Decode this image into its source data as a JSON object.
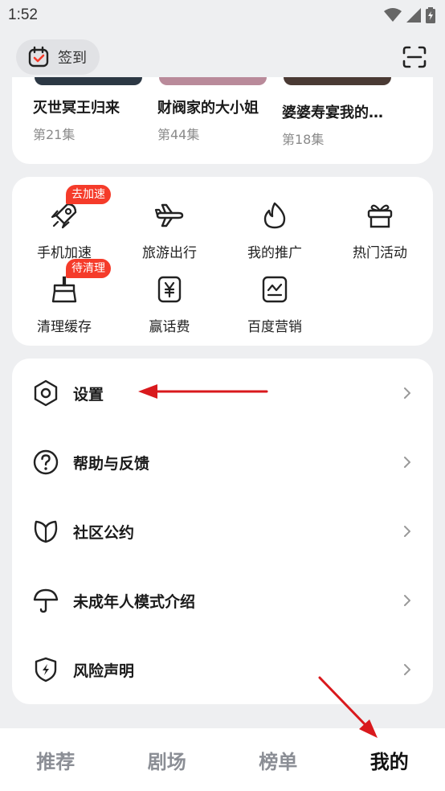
{
  "status_bar": {
    "time": "1:52"
  },
  "header": {
    "signin_label": "签到"
  },
  "dramas": [
    {
      "title": "灭世冥王归来",
      "episode": "第21集"
    },
    {
      "title": "财阀家的大小姐",
      "episode": "第44集"
    },
    {
      "title": "婆婆寿宴我的…",
      "episode": "第18集"
    }
  ],
  "tools": [
    {
      "label": "手机加速",
      "icon": "rocket-icon",
      "badge": "去加速"
    },
    {
      "label": "旅游出行",
      "icon": "airplane-icon"
    },
    {
      "label": "我的推广",
      "icon": "flame-icon"
    },
    {
      "label": "热门活动",
      "icon": "gift-icon"
    },
    {
      "label": "清理缓存",
      "icon": "broom-icon",
      "badge": "待清理"
    },
    {
      "label": "赢话费",
      "icon": "yuan-icon"
    },
    {
      "label": "百度营销",
      "icon": "chart-icon"
    }
  ],
  "menu": [
    {
      "label": "设置",
      "icon": "settings-icon"
    },
    {
      "label": "帮助与反馈",
      "icon": "help-icon"
    },
    {
      "label": "社区公约",
      "icon": "leaf-icon"
    },
    {
      "label": "未成年人模式介绍",
      "icon": "umbrella-icon"
    },
    {
      "label": "风险声明",
      "icon": "shield-icon"
    }
  ],
  "bottom_nav": [
    {
      "label": "推荐",
      "active": false
    },
    {
      "label": "剧场",
      "active": false
    },
    {
      "label": "榜单",
      "active": false
    },
    {
      "label": "我的",
      "active": true
    }
  ],
  "colors": {
    "badge": "#f53b2a",
    "accent_arrow": "#d9191d",
    "background": "#eeeff1"
  }
}
